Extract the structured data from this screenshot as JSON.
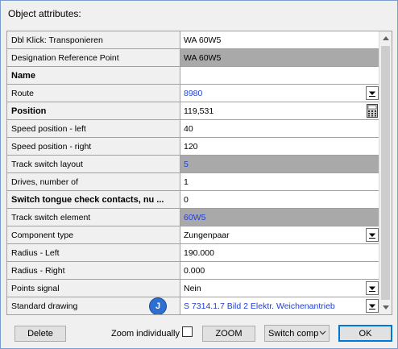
{
  "dialog": {
    "title": "Object attributes:"
  },
  "attributes": [
    {
      "name": "Dbl Klick: Transponieren",
      "value": "WA 60W5",
      "bold": false,
      "gray": false,
      "blue": false,
      "control": "none"
    },
    {
      "name": "Designation Reference Point",
      "value": "WA 60W5",
      "bold": false,
      "gray": true,
      "blue": false,
      "control": "none"
    },
    {
      "name": "Name",
      "value": "",
      "bold": true,
      "gray": false,
      "blue": false,
      "control": "none"
    },
    {
      "name": "Route",
      "value": "8980",
      "bold": false,
      "gray": false,
      "blue": true,
      "control": "dropdown"
    },
    {
      "name": "Position",
      "value": "119,531",
      "bold": true,
      "gray": false,
      "blue": false,
      "control": "calculator"
    },
    {
      "name": "Speed position - left",
      "value": "40",
      "bold": false,
      "gray": false,
      "blue": false,
      "control": "none"
    },
    {
      "name": "Speed position - right",
      "value": "120",
      "bold": false,
      "gray": false,
      "blue": false,
      "control": "none"
    },
    {
      "name": "Track switch layout",
      "value": "5",
      "bold": false,
      "gray": true,
      "blue": true,
      "control": "none"
    },
    {
      "name": "Drives, number of",
      "value": "1",
      "bold": false,
      "gray": false,
      "blue": false,
      "control": "none"
    },
    {
      "name": "Switch tongue check contacts, nu ...",
      "value": "0",
      "bold": true,
      "gray": false,
      "blue": false,
      "control": "none"
    },
    {
      "name": "Track switch element",
      "value": "60W5",
      "bold": false,
      "gray": true,
      "blue": true,
      "control": "none"
    },
    {
      "name": "Component type",
      "value": "Zungenpaar",
      "bold": false,
      "gray": false,
      "blue": false,
      "control": "dropdown"
    },
    {
      "name": "Radius - Left",
      "value": "190.000",
      "bold": false,
      "gray": false,
      "blue": false,
      "control": "none"
    },
    {
      "name": "Radius - Right",
      "value": "0.000",
      "bold": false,
      "gray": false,
      "blue": false,
      "control": "none"
    },
    {
      "name": "Points signal",
      "value": "Nein",
      "bold": false,
      "gray": false,
      "blue": false,
      "control": "dropdown"
    },
    {
      "name": "Standard drawing",
      "value": "S 7314.1.7 Bild 2 Elektr. Weichenantrieb",
      "bold": false,
      "gray": false,
      "blue": true,
      "control": "dropdown",
      "badge": "J"
    }
  ],
  "footer": {
    "delete_label": "Delete",
    "zoom_individually_label": "Zoom individually",
    "zoom_individually_checked": false,
    "zoom_label": "ZOOM",
    "switch_combo_value": "Switch comp",
    "ok_label": "OK"
  },
  "colors": {
    "gray_cell": "#a9a9a9",
    "blue_text": "#1f3fd6",
    "badge": "#2f6fd0",
    "ok_border": "#0078d7"
  },
  "icons": {
    "dropdown": "chevron-down-icon",
    "calculator": "calculator-icon",
    "scroll_up": "arrow-up-icon",
    "scroll_down": "arrow-down-icon"
  }
}
